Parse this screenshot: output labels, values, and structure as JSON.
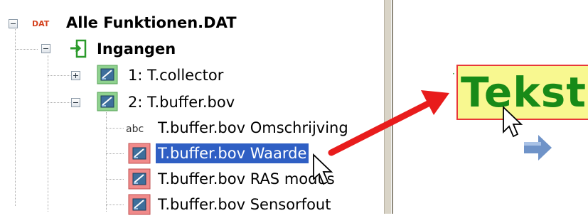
{
  "tree": {
    "root": {
      "label": "Alle Funktionen.DAT",
      "icon": "dat-file-icon",
      "icon_text": "DAT"
    },
    "inputs": {
      "label": "Ingangen",
      "icon": "input-icon"
    },
    "items": [
      {
        "label": "1: T.collector",
        "expanded": false
      },
      {
        "label": "2: T.buffer.bov",
        "expanded": true
      }
    ],
    "children": [
      {
        "label": "T.buffer.bov Omschrijving",
        "icon": "abc-icon",
        "icon_text": "abc"
      },
      {
        "label": "T.buffer.bov Waarde",
        "icon": "value-icon",
        "selected": true
      },
      {
        "label": "T.buffer.bov RAS modus",
        "icon": "value-icon"
      },
      {
        "label": "T.buffer.bov Sensorfout",
        "icon": "value-icon"
      }
    ]
  },
  "canvas": {
    "text_object": "Tekst"
  },
  "colors": {
    "selection": "#2f5fc4",
    "drag_arrow": "#e81c1c",
    "text_object_fill": "#f8f890",
    "text_object_border": "#e83838",
    "text_object_font": "#188a18",
    "nav_arrow": "#6f93c8"
  }
}
